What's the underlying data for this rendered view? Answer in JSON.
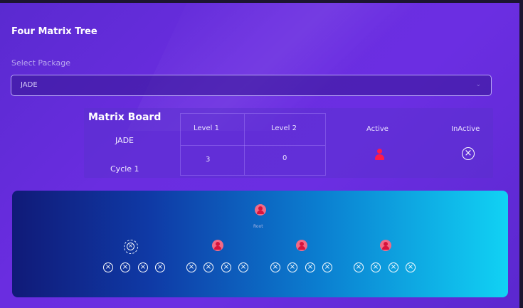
{
  "page": {
    "title": "Four Matrix Tree"
  },
  "package_select": {
    "label": "Select Package",
    "selected": "JADE"
  },
  "matrix_board": {
    "title": "Matrix Board",
    "package": "JADE",
    "cycle": "Cycle 1",
    "columns": [
      "Level 1",
      "Level 2"
    ],
    "values": [
      "3",
      "0"
    ],
    "legend": {
      "active_label": "Active",
      "inactive_label": "InActive",
      "active_color": "#ff1a4a"
    }
  },
  "tree": {
    "root": {
      "label": "Root",
      "icon": "user-icon",
      "status": "active"
    },
    "children": [
      {
        "status": "inactive",
        "selected": true,
        "grandchildren": [
          "inactive",
          "inactive",
          "inactive",
          "inactive"
        ]
      },
      {
        "status": "active",
        "selected": false,
        "grandchildren": [
          "inactive",
          "inactive",
          "inactive",
          "inactive"
        ]
      },
      {
        "status": "active",
        "selected": false,
        "grandchildren": [
          "inactive",
          "inactive",
          "inactive",
          "inactive"
        ]
      },
      {
        "status": "active",
        "selected": false,
        "grandchildren": [
          "inactive",
          "inactive",
          "inactive",
          "inactive"
        ]
      }
    ]
  },
  "icons": {
    "active": "user-icon",
    "inactive": "circle-x-icon"
  }
}
